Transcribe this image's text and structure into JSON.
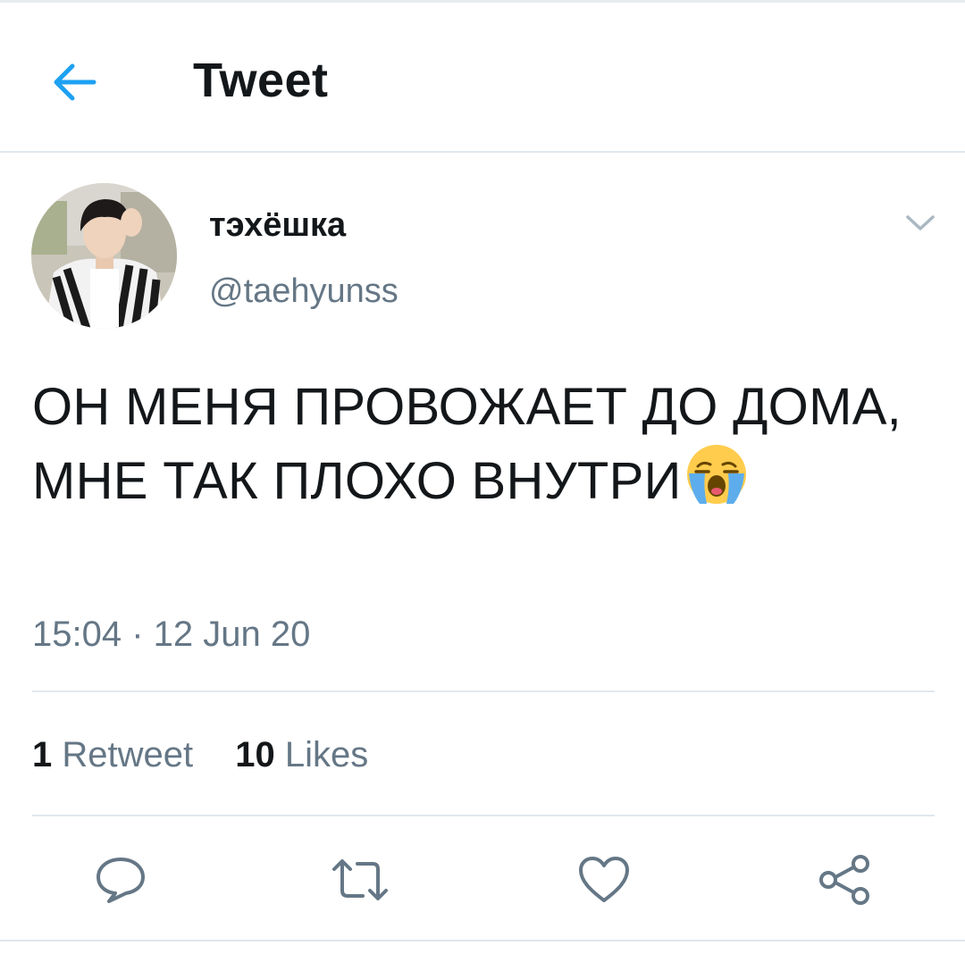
{
  "header": {
    "title": "Tweet",
    "back_icon": "arrow-left-icon",
    "accent_color": "#1da1f2"
  },
  "tweet": {
    "author": {
      "display_name": "тэхёшка",
      "handle": "@taehyunss"
    },
    "text": "ОН МЕНЯ ПРОВОЖАЕТ ДО ДОМА, МНЕ ТАК ПЛОХО ВНУТРИ",
    "emoji": "loudly-crying-face",
    "timestamp": "15:04 · 12 Jun 20"
  },
  "stats": {
    "retweets_count": "1",
    "retweets_label": "Retweet",
    "likes_count": "10",
    "likes_label": "Likes"
  },
  "actions": [
    "reply-icon",
    "retweet-icon",
    "like-icon",
    "share-icon"
  ],
  "colors": {
    "text_primary": "#14171a",
    "text_secondary": "#657786",
    "divider": "#e1e8ed",
    "icon": "#657786"
  }
}
